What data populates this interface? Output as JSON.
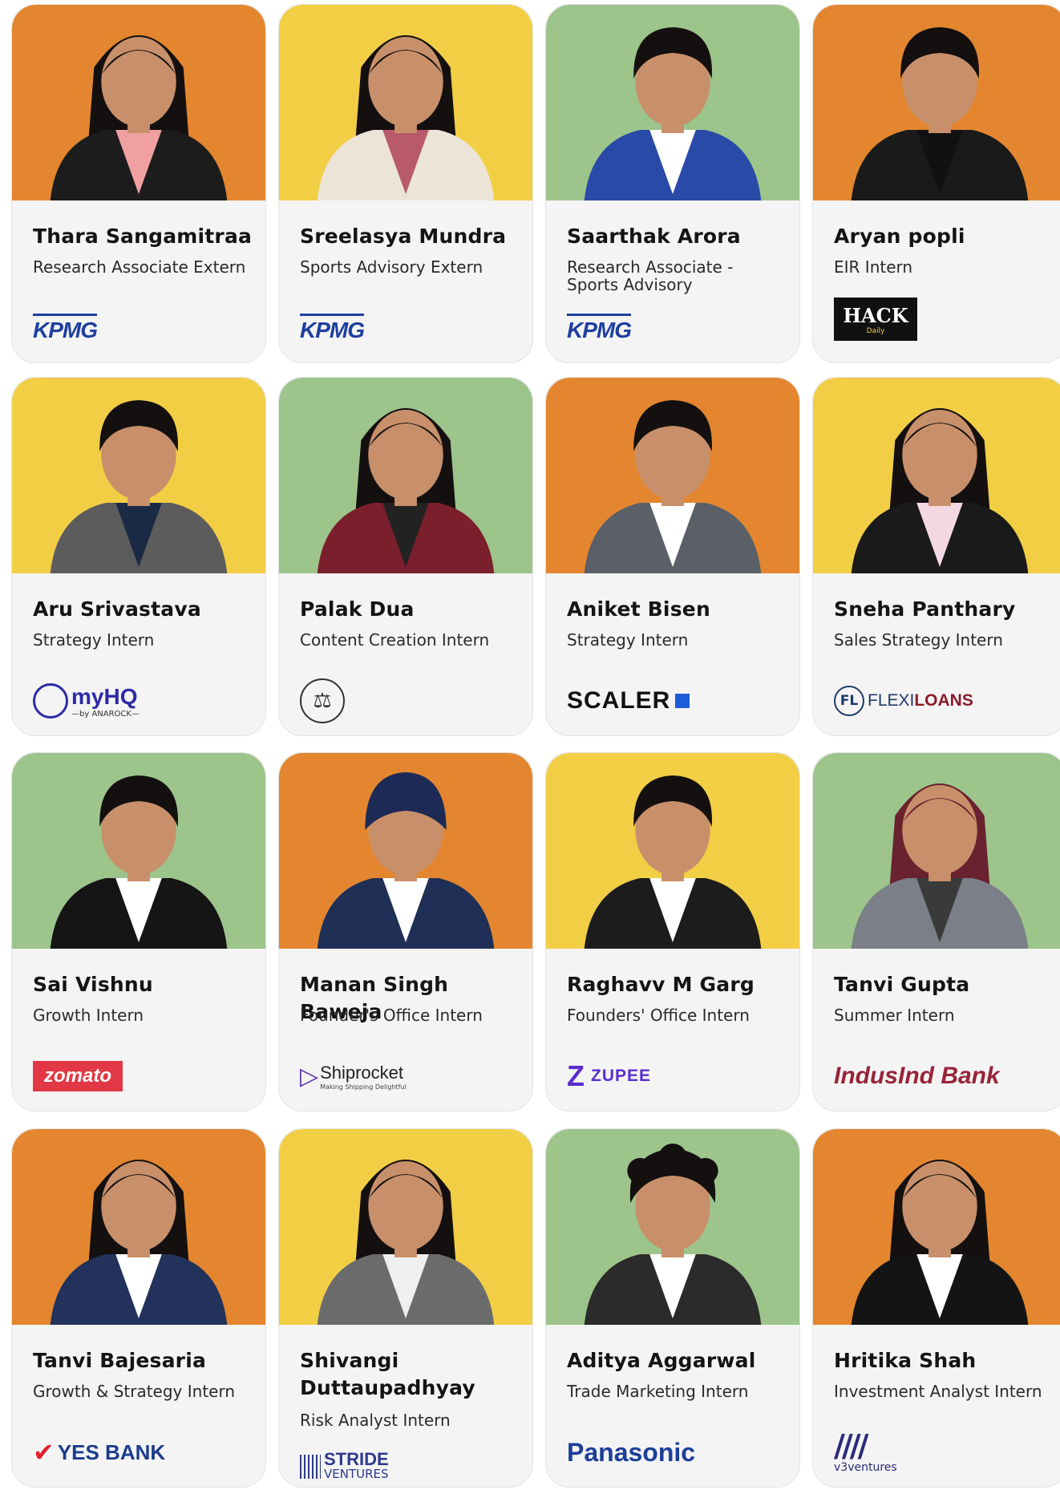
{
  "colors": {
    "orange": "#e3862f",
    "yellow": "#f2ce45",
    "green": "#9cc48b",
    "card": "#f4f4f4"
  },
  "cards": [
    {
      "name": "Thara Sangamitraa",
      "role": "Research Associate Extern",
      "logo": "KPMG",
      "bg": "orange",
      "shirt": "#f0a0a0",
      "suit": "#1c1c1c",
      "hair": "long"
    },
    {
      "name": "Sreelasya Mundra",
      "role": "Sports Advisory Extern",
      "logo": "KPMG",
      "bg": "yellow",
      "shirt": "#b85a6a",
      "suit": "#ece4d6",
      "hair": "long"
    },
    {
      "name": "Saarthak Arora",
      "role": "Research Associate - Sports Advisory",
      "logo": "KPMG",
      "bg": "green",
      "shirt": "#ffffff",
      "suit": "#2a4aa8",
      "hair": "short"
    },
    {
      "name": "Aryan popli",
      "role": "EIR Intern",
      "logo": "HACK",
      "logo_sub": "Daily",
      "bg": "orange",
      "shirt": "#111111",
      "suit": "#1a1a1a",
      "hair": "short"
    },
    {
      "name": "Aru Srivastava",
      "role": "Strategy Intern",
      "logo": "myHQ",
      "logo_sub": "—by ANAROCK—",
      "bg": "yellow",
      "shirt": "#1b2a44",
      "suit": "#5c5c5c",
      "hair": "short"
    },
    {
      "name": "Palak Dua",
      "role": "Content Creation Intern",
      "logo": "emblem",
      "bg": "green",
      "shirt": "#222222",
      "suit": "#7a1f2b",
      "hair": "long"
    },
    {
      "name": "Aniket Bisen",
      "role": "Strategy Intern",
      "logo": "SCALER",
      "bg": "orange",
      "shirt": "#ffffff",
      "suit": "#5a5f68",
      "hair": "short"
    },
    {
      "name": "Sneha Panthary",
      "role": "Sales Strategy Intern",
      "logo": "FLEXILOANS",
      "logo_a": "FLEXI",
      "logo_b": "LOANS",
      "bg": "yellow",
      "shirt": "#f3d8e4",
      "suit": "#1a1a1a",
      "hair": "long"
    },
    {
      "name": "Sai Vishnu",
      "role": "Growth Intern",
      "logo": "zomato",
      "bg": "green",
      "shirt": "#ffffff",
      "suit": "#151515",
      "hair": "short"
    },
    {
      "name": "Manan Singh Baweja",
      "role": "Founder's Office Intern",
      "logo": "Shiprocket",
      "logo_sub": "Making Shipping Delightful",
      "bg": "orange",
      "shirt": "#ffffff",
      "suit": "#1f2f55",
      "hair": "turban"
    },
    {
      "name": "Raghavv M Garg",
      "role": "Founders' Office Intern",
      "logo": "ZUPEE",
      "bg": "yellow",
      "shirt": "#ffffff",
      "suit": "#1c1c1c",
      "hair": "short"
    },
    {
      "name": "Tanvi Gupta",
      "role": "Summer Intern",
      "logo": "IndusInd Bank",
      "bg": "green",
      "shirt": "#3a3a3a",
      "suit": "#7a7f88",
      "hair": "long-red"
    },
    {
      "name": "Tanvi Bajesaria",
      "role": "Growth & Strategy Intern",
      "logo": "YES BANK",
      "bg": "orange",
      "shirt": "#ffffff",
      "suit": "#22325a",
      "hair": "long"
    },
    {
      "name": "Shivangi Duttaupadhyay",
      "role": "Risk Analyst Intern",
      "logo": "STRIDE",
      "logo_sub": "VENTURES",
      "bg": "yellow",
      "shirt": "#efefef",
      "suit": "#6b6b6b",
      "hair": "long"
    },
    {
      "name": "Aditya Aggarwal",
      "role": "Trade Marketing Intern",
      "logo": "Panasonic",
      "bg": "green",
      "shirt": "#ffffff",
      "suit": "#2b2b2b",
      "hair": "curly"
    },
    {
      "name": "Hritika Shah",
      "role": "Investment Analyst Intern",
      "logo": "v3ventures",
      "bg": "orange",
      "shirt": "#ffffff",
      "suit": "#141414",
      "hair": "long"
    }
  ]
}
